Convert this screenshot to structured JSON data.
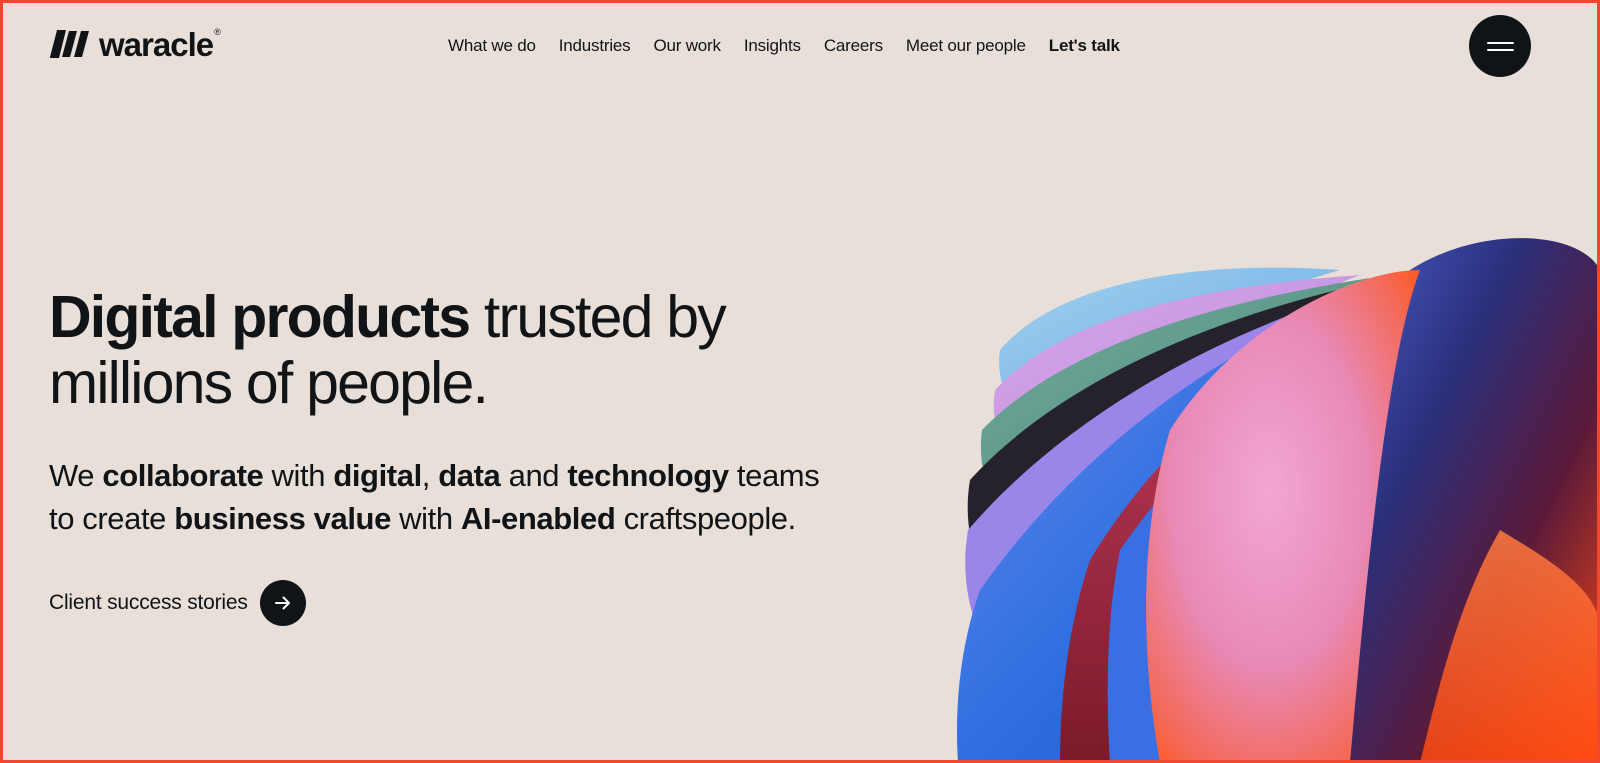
{
  "brand": {
    "name": "waracle",
    "reg": "®"
  },
  "nav": {
    "items": [
      "What we do",
      "Industries",
      "Our work",
      "Insights",
      "Careers",
      "Meet our people"
    ],
    "cta": "Let's talk"
  },
  "hero": {
    "headline_bold": "Digital products",
    "headline_rest_1": " trusted by",
    "headline_rest_2": "millions of people.",
    "sub": {
      "t1": "We ",
      "b1": "collaborate",
      "t2": " with ",
      "b2": "digital",
      "t3": ", ",
      "b3": "data",
      "t4": " and ",
      "b4": "technology",
      "t5": " teams",
      "t6": "to create ",
      "b5": "business value",
      "t7": " with ",
      "b6": "AI-enabled",
      "t8": " craftspeople."
    },
    "cta_label": "Client success stories"
  },
  "icons": {
    "menu": "hamburger-icon",
    "cta": "arrow-right-icon"
  },
  "colors": {
    "background": "#e9dfd9",
    "text": "#111417",
    "button": "#0f1417",
    "frame": "#f0472f"
  }
}
